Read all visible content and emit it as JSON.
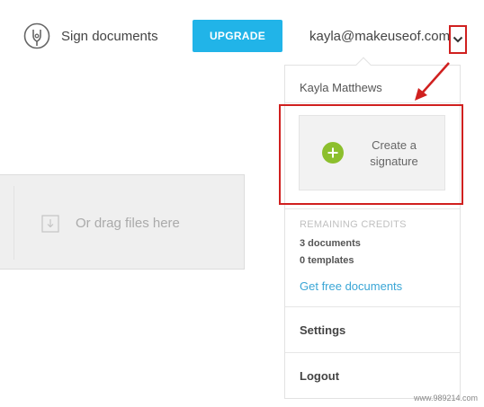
{
  "header": {
    "sign_label": "Sign documents",
    "upgrade_label": "UPGRADE",
    "email": "kayla@makeuseof.com",
    "dropdown_icon": "chevron-down-icon"
  },
  "dropzone": {
    "text": "Or drag files here"
  },
  "dropdown": {
    "user_name": "Kayla Matthews",
    "create_signature_line1": "Create a",
    "create_signature_line2": "signature",
    "credits_title": "REMAINING CREDITS",
    "credits_documents": "3 documents",
    "credits_templates": "0 templates",
    "free_documents_link": "Get free documents",
    "settings_label": "Settings",
    "logout_label": "Logout"
  },
  "watermark": "www.989214.com",
  "colors": {
    "upgrade_bg": "#21b4e8",
    "plus_green": "#8cbf2d",
    "annotation_red": "#d0201f",
    "link_blue": "#3aa6d6"
  }
}
